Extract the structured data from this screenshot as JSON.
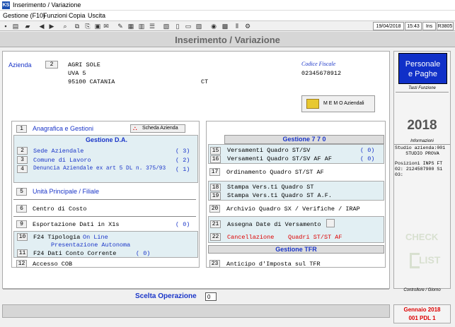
{
  "window": {
    "title": "Inserimento / Variazione"
  },
  "menubar": {
    "items": [
      "Gestione (F10)",
      "Funzioni",
      "Copia",
      "Uscita"
    ]
  },
  "toolbar": {
    "date": "19/04/2018",
    "time": "15:43",
    "mode": "Ins",
    "version": "R3805"
  },
  "header": {
    "title": "Inserimento / Variazione"
  },
  "company": {
    "label": "Azienda",
    "code": "2",
    "name": "AGRI SOLE",
    "address": "UVA 5",
    "city": "95100 CATANIA",
    "province": "CT",
    "fiscal_label": "Codice Fiscale",
    "fiscal_code": "02345678912",
    "memo_label": "M E M O Aziendali"
  },
  "left": {
    "anagrafica": {
      "num": "1",
      "label": "Anagrafica e Gestioni",
      "scheda_button": "Scheda Azienda"
    },
    "gestione_da": {
      "title": "Gestione D.A.",
      "rows": [
        {
          "num": "2",
          "label": "Sede Aziendale",
          "count": "( 3)"
        },
        {
          "num": "3",
          "label": "Comune di Lavoro",
          "count": "( 2)"
        },
        {
          "num": "4",
          "label": "Denuncia Aziendale ex art 5 DL n. 375/93",
          "count": "( 1)"
        }
      ]
    },
    "unita": {
      "num": "5",
      "label": "Unità Principale / Filiale"
    },
    "centro": {
      "num": "6",
      "label": "Centro di Costo"
    },
    "esportazione": {
      "num": "9",
      "label": "Esportazione Dati in X1s",
      "count": "( 0)"
    },
    "f24": {
      "num_top": "10",
      "num_bottom": "11",
      "tipologia_label": "F24 Tipologia",
      "tipologia_value": "On Line",
      "presentazione": "Presentazione Autonoma",
      "dati_label": "F24 Dati Conto Corrente",
      "dati_count": "( 0)"
    },
    "cob": {
      "num": "12",
      "label": "Accesso COB"
    }
  },
  "right": {
    "gestione770": {
      "title": "Gestione 7 7 0",
      "rows": [
        {
          "num": "15",
          "label": "Versamenti Quadro ST/SV",
          "count": "( 0)"
        },
        {
          "num": "16",
          "label": "Versamenti Quadro ST/SV AF AF",
          "count": "( 0)"
        },
        {
          "num": "17",
          "label": "Ordinamento Quadro ST/ST AF"
        },
        {
          "num": "18",
          "label": "Stampa Vers.ti Quadro ST"
        },
        {
          "num": "19",
          "label": "Stampa Vers.ti Quadro ST A.F."
        },
        {
          "num": "20",
          "label": "Archivio Quadro SX / Verifiche / IRAP"
        },
        {
          "num": "21",
          "label": "Assegna Date di Versamento"
        },
        {
          "num": "22",
          "label_a": "Cancellazione",
          "label_b": "Quadri ST/ST AF"
        }
      ]
    },
    "tfr": {
      "title": "Gestione TFR",
      "num": "23",
      "label": "Anticipo d'Imposta sul TFR"
    }
  },
  "scelta": {
    "label": "Scelta Operazione",
    "value": "0"
  },
  "sidepanel": {
    "brand_line1": "Personale",
    "brand_line2": "e Paghe",
    "tasti_label": "Tasti Funzione",
    "year": "2018",
    "info_label": "Informazioni",
    "info_lines": [
      "Studio azienda:001",
      "STUDIO PROVA",
      "Posizioni INPS  FT",
      "02: 2124587900  S1",
      "03:"
    ],
    "check_word1": "CHECK",
    "check_word2": "LIST",
    "controllo_label": "Controllore / Giorno",
    "period": "Gennaio  2018",
    "pdl": "001 PDL 1"
  },
  "colors": {
    "accent_blue": "#1a35c8",
    "brand_bg": "#1030c8",
    "alert_red": "#d00000"
  }
}
